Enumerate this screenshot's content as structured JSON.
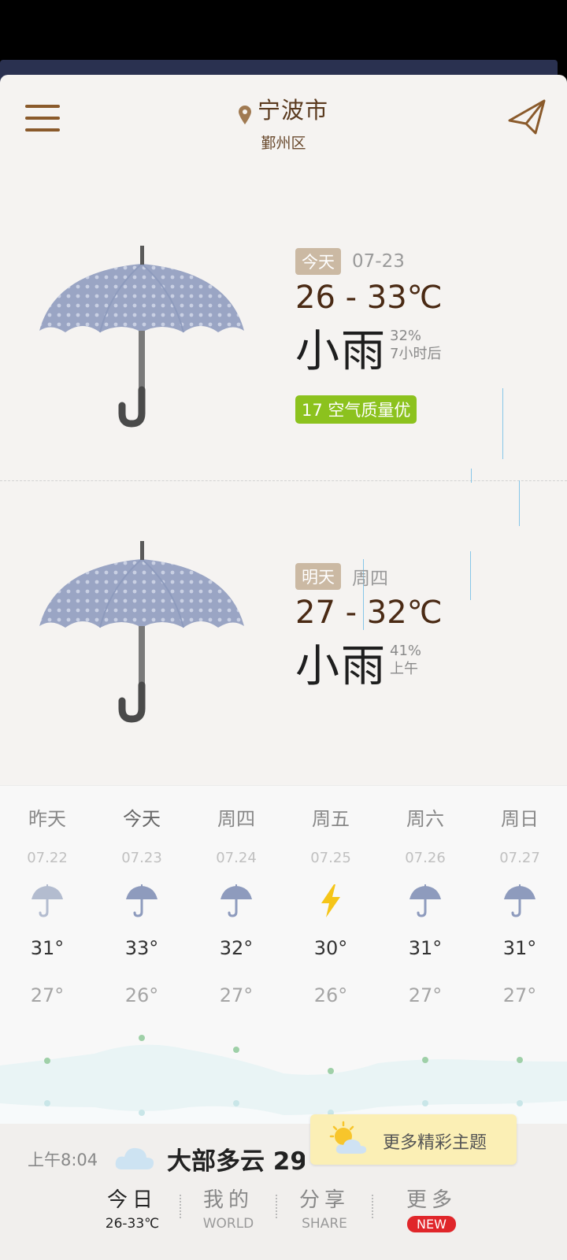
{
  "header": {
    "city": "宁波市",
    "district": "鄞州区"
  },
  "today": {
    "tag": "今天",
    "date": "07-23",
    "range": "26 - 33℃",
    "condition": "小雨",
    "precip": "32%",
    "precip_time": "7小时后",
    "aqi": "17 空气质量优"
  },
  "tomorrow": {
    "tag": "明天",
    "weekday": "周四",
    "range": "27 - 32℃",
    "condition": "小雨",
    "precip": "41%",
    "precip_time": "上午"
  },
  "forecast": [
    {
      "day": "昨天",
      "date": "07.22",
      "icon": "umbrella-icon",
      "hi": "31°",
      "lo": "27°"
    },
    {
      "day": "今天",
      "date": "07.23",
      "icon": "umbrella-icon",
      "hi": "33°",
      "lo": "26°"
    },
    {
      "day": "周四",
      "date": "07.24",
      "icon": "umbrella-icon",
      "hi": "32°",
      "lo": "27°"
    },
    {
      "day": "周五",
      "date": "07.25",
      "icon": "lightning-icon",
      "hi": "30°",
      "lo": "26°"
    },
    {
      "day": "周六",
      "date": "07.26",
      "icon": "umbrella-icon",
      "hi": "31°",
      "lo": "27°"
    },
    {
      "day": "周日",
      "date": "07.27",
      "icon": "umbrella-icon",
      "hi": "31°",
      "lo": "27°"
    }
  ],
  "now": {
    "time": "上午8:04",
    "text": "大部多云 29°"
  },
  "theme_popup": "更多精彩主题",
  "nav": [
    {
      "main": "今日",
      "sub": "26-33℃"
    },
    {
      "main": "我的",
      "sub": "WORLD"
    },
    {
      "main": "分享",
      "sub": "SHARE"
    },
    {
      "main": "更多",
      "sub": "NEW"
    }
  ],
  "colors": {
    "accent": "#8a5a2b",
    "aqi_green": "#8cc21e",
    "new_badge": "#e0262a",
    "umbrella": "#8e9bbd"
  }
}
